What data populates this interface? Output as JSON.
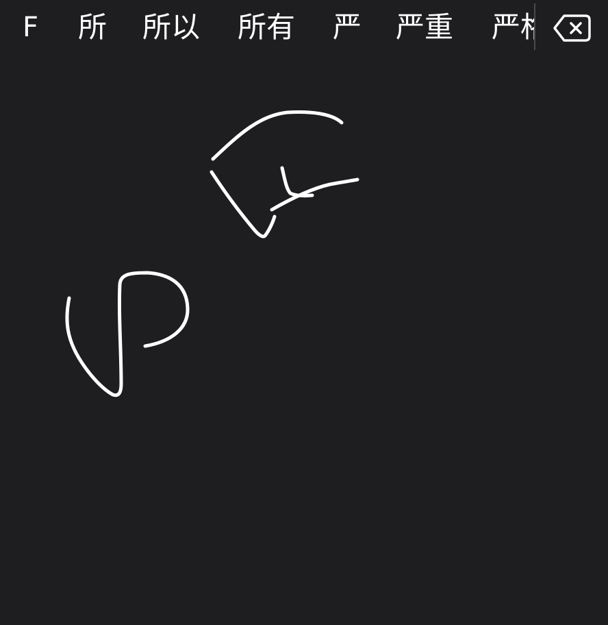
{
  "candidates": [
    "F",
    "所",
    "所以",
    "所有",
    "严",
    "严重",
    "严格"
  ],
  "colors": {
    "background": "#1e1d20",
    "text": "#ffffff",
    "ink": "#ffffff",
    "divider": "#4a4a4e"
  },
  "icons": {
    "delete": "backspace-icon"
  }
}
